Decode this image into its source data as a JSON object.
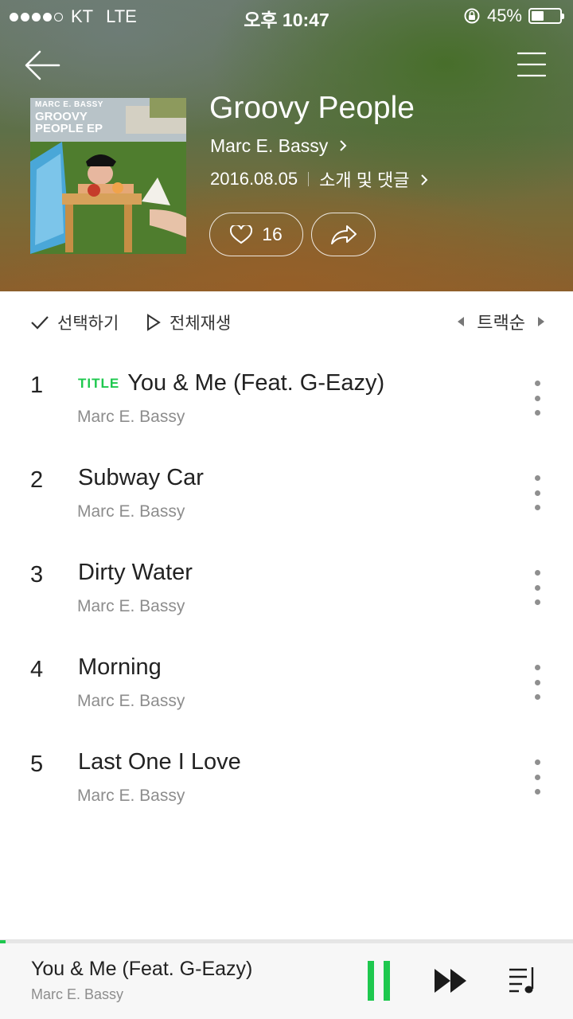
{
  "status_bar": {
    "carrier": "KT",
    "network": "LTE",
    "time": "오후 10:47",
    "battery": "45%",
    "battery_level": 0.45,
    "signal_bars": 4,
    "signal_total": 5
  },
  "header": {
    "back_icon": "arrow-left-icon",
    "menu_icon": "hamburger-menu-icon"
  },
  "album": {
    "art_text_small": "MARC E. BASSY",
    "art_text_big": "GROOVY PEOPLE EP",
    "title": "Groovy People",
    "artist": "Marc E. Bassy",
    "release_date": "2016.08.05",
    "intro_link": "소개 및 댓글",
    "like_count": "16"
  },
  "toolbar": {
    "select_label": "선택하기",
    "play_all_label": "전체재생",
    "sort_label": "트랙순"
  },
  "tracks": [
    {
      "number": "1",
      "badge": "TITLE",
      "title": "You & Me (Feat. G-Eazy)",
      "artist": "Marc E. Bassy"
    },
    {
      "number": "2",
      "badge": "",
      "title": "Subway Car",
      "artist": "Marc E. Bassy"
    },
    {
      "number": "3",
      "badge": "",
      "title": "Dirty Water",
      "artist": "Marc E. Bassy"
    },
    {
      "number": "4",
      "badge": "",
      "title": "Morning",
      "artist": "Marc E. Bassy"
    },
    {
      "number": "5",
      "badge": "",
      "title": "Last One I Love",
      "artist": "Marc E. Bassy"
    }
  ],
  "player": {
    "now_title": "You & Me (Feat. G-Eazy)",
    "now_artist": "Marc E. Bassy",
    "progress": 0.01
  },
  "colors": {
    "accent": "#1ec84e",
    "secondary_text": "#8d8d8d"
  }
}
